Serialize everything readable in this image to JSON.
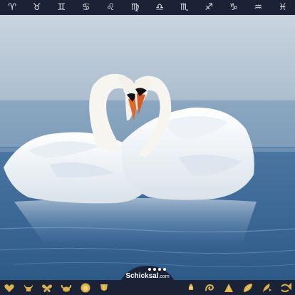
{
  "top_bar": {
    "signs": [
      {
        "name": "aries",
        "glyph": "♈︎"
      },
      {
        "name": "taurus",
        "glyph": "♉︎"
      },
      {
        "name": "gemini",
        "glyph": "♊︎"
      },
      {
        "name": "cancer",
        "glyph": "♋︎"
      },
      {
        "name": "leo",
        "glyph": "♌︎"
      },
      {
        "name": "virgo",
        "glyph": "♍︎"
      },
      {
        "name": "libra",
        "glyph": "♎︎"
      },
      {
        "name": "scorpio",
        "glyph": "♏︎"
      },
      {
        "name": "sagittarius",
        "glyph": "♐︎"
      },
      {
        "name": "capricorn",
        "glyph": "♑︎"
      },
      {
        "name": "aquarius",
        "glyph": "♒︎"
      },
      {
        "name": "pisces",
        "glyph": "♓︎"
      }
    ]
  },
  "logo": {
    "brand": "Schicksal",
    "suffix": ".com"
  },
  "bottom_bar": {
    "icons": [
      "heart-icon",
      "bull-icon",
      "butterfly-icon",
      "crab-icon",
      "lion-icon",
      "wheat-icon",
      "scales-icon",
      "scorpion-icon",
      "bow-icon",
      "leaf-icon",
      "feather-icon",
      "fish-icon"
    ]
  },
  "colors": {
    "bar": "#1c2235",
    "gold": "#d8b24a",
    "glyph": "#e8e8ea",
    "water": "#3e6e9c"
  }
}
